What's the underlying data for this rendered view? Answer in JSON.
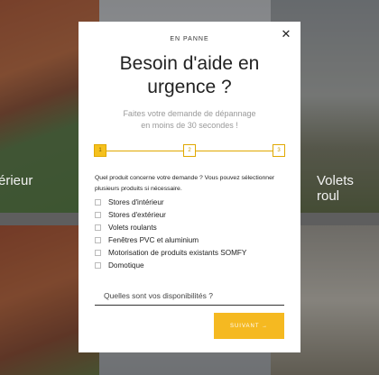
{
  "background": {
    "label_left": "érieur",
    "label_right": "Volets roul"
  },
  "modal": {
    "eyebrow": "EN PANNE",
    "title_line1": "Besoin d'aide en",
    "title_line2": "urgence ?",
    "subtitle_line1": "Faites votre demande de dépannage",
    "subtitle_line2": "en moins de 30 secondes !",
    "close_icon": "close-icon",
    "steps": [
      "1",
      "2",
      "3"
    ],
    "active_step": "1",
    "question": "Quel produit concerne votre demande ? Vous pouvez sélectionner plusieurs produits si nécessaire.",
    "options": [
      "Stores d'intérieur",
      "Stores d'extérieur",
      "Volets roulants",
      "Fenêtres PVC et aluminium",
      "Motorisation de produits existants SOMFY",
      "Domotique"
    ],
    "dispo_placeholder": "Quelles sont vos disponibilités ?",
    "next_label": "SUIVANT →",
    "accent_color": "#f5b921"
  }
}
